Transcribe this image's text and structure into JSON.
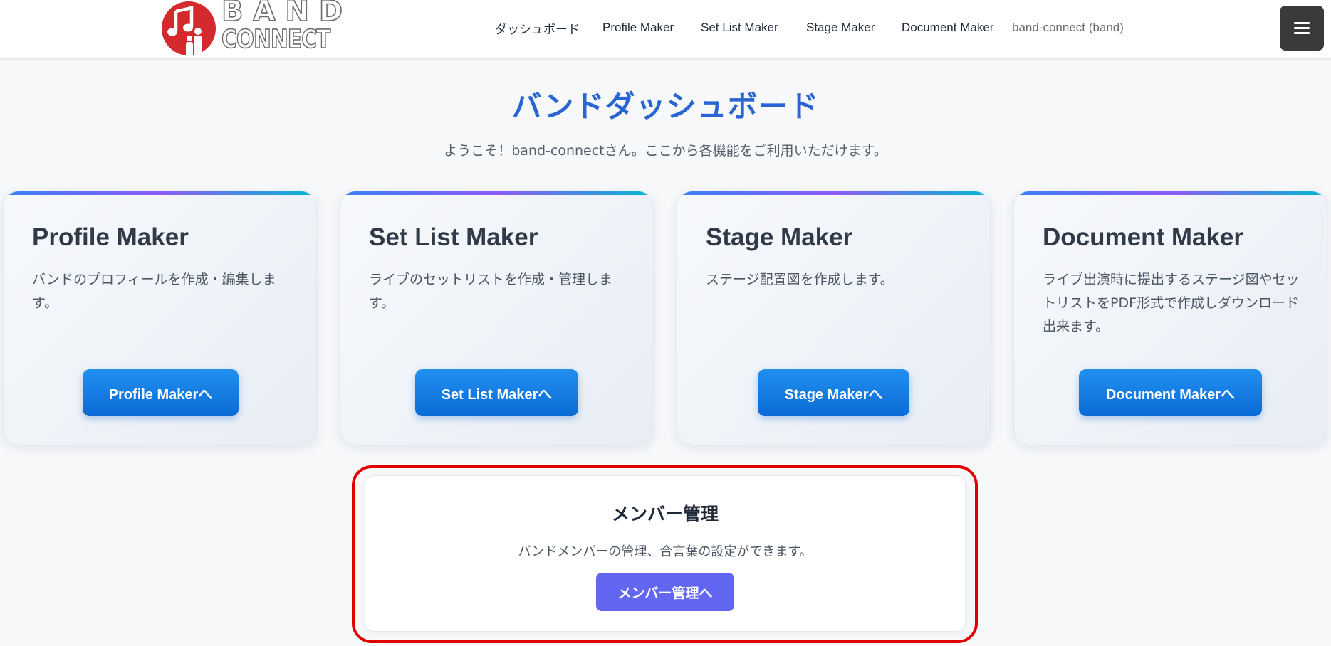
{
  "header": {
    "logo": {
      "line1": "BAND",
      "line2": "CONNECT"
    },
    "nav": [
      {
        "label": "ダッシュボード"
      },
      {
        "label": "Profile Maker"
      },
      {
        "label": "Set List Maker"
      },
      {
        "label": "Stage Maker"
      },
      {
        "label": "Document Maker"
      }
    ],
    "user": "band-connect (band)",
    "menu_icon": "hamburger-icon"
  },
  "page": {
    "title": "バンドダッシュボード",
    "subtitle": "ようこそ！band-connectさん。ここから各機能をご利用いただけます。"
  },
  "cards": [
    {
      "title": "Profile Maker",
      "description": "バンドのプロフィールを作成・編集します。",
      "button": "Profile Makerへ"
    },
    {
      "title": "Set List Maker",
      "description": "ライブのセットリストを作成・管理します。",
      "button": "Set List Makerへ"
    },
    {
      "title": "Stage Maker",
      "description": "ステージ配置図を作成します。",
      "button": "Stage Makerへ"
    },
    {
      "title": "Document Maker",
      "description": "ライブ出演時に提出するステージ図やセットリストをPDF形式で作成しダウンロード出来ます。",
      "button": "Document Makerへ"
    }
  ],
  "member": {
    "title": "メンバー管理",
    "description": "バンドメンバーの管理、合言葉の設定ができます。",
    "button": "メンバー管理へ"
  },
  "colors": {
    "accent_title": "#2a66d3",
    "card_button": "#1a7de6",
    "member_button": "#6366f1",
    "highlight": "#e00000",
    "logo_red": "#d42a2d"
  }
}
